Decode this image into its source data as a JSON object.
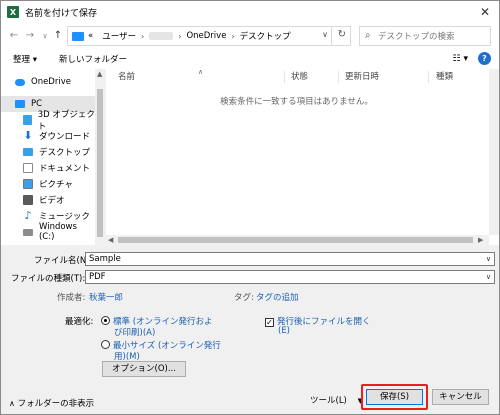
{
  "window": {
    "title": "名前を付けて保存",
    "app_icon": "X"
  },
  "address": {
    "prefix": "«",
    "crumbs": [
      "ユーザー",
      "OneDrive",
      "デスクトップ"
    ],
    "search_placeholder": "デスクトップの検索"
  },
  "toolbar": {
    "organize": "整理 ▾",
    "new_folder": "新しいフォルダー",
    "help": "?"
  },
  "nav": {
    "items": [
      {
        "label": "OneDrive",
        "color": "#1e90ff"
      },
      {
        "label": "PC",
        "color": "#1e90ff"
      },
      {
        "label": "3D オブジェクト",
        "color": "#3aa0e8"
      },
      {
        "label": "ダウンロード",
        "color": "#1f6fd1"
      },
      {
        "label": "デスクトップ",
        "color": "#3aa0e8"
      },
      {
        "label": "ドキュメント",
        "color": "#8c8c8c"
      },
      {
        "label": "ピクチャ",
        "color": "#3aa0e8"
      },
      {
        "label": "ビデオ",
        "color": "#5a5a5a"
      },
      {
        "label": "ミュージック",
        "color": "#1f6fd1"
      },
      {
        "label": "Windows (C:)",
        "color": "#8c8c8c"
      }
    ]
  },
  "columns": {
    "name": "名前",
    "status": "状態",
    "date": "更新日時",
    "type": "種類"
  },
  "empty_message": "検索条件に一致する項目はありません。",
  "form": {
    "filename_label": "ファイル名(N):",
    "filename_value": "Sample",
    "filetype_label": "ファイルの種類(T):",
    "filetype_value": "PDF",
    "author_label": "作成者:",
    "author_value": "秋葉一郎",
    "tags_label": "タグ:",
    "tags_value": "タグの追加",
    "optimize_label": "最適化:",
    "opt_standard_1": "標準 (オンライン発行およ",
    "opt_standard_2": "び印刷)(A)",
    "opt_min_1": "最小サイズ (オンライン発行",
    "opt_min_2": "用)(M)",
    "open_after_1": "発行後にファイルを開く",
    "open_after_2": "(E)",
    "options_button": "オプション(O)..."
  },
  "footer": {
    "hide_folders": "フォルダーの非表示",
    "tools": "ツール(L)",
    "save": "保存(S)",
    "cancel": "キャンセル"
  },
  "colors": {
    "highlight": "#e8201c",
    "link": "#1a5fb4",
    "primary_border": "#0078d7"
  }
}
